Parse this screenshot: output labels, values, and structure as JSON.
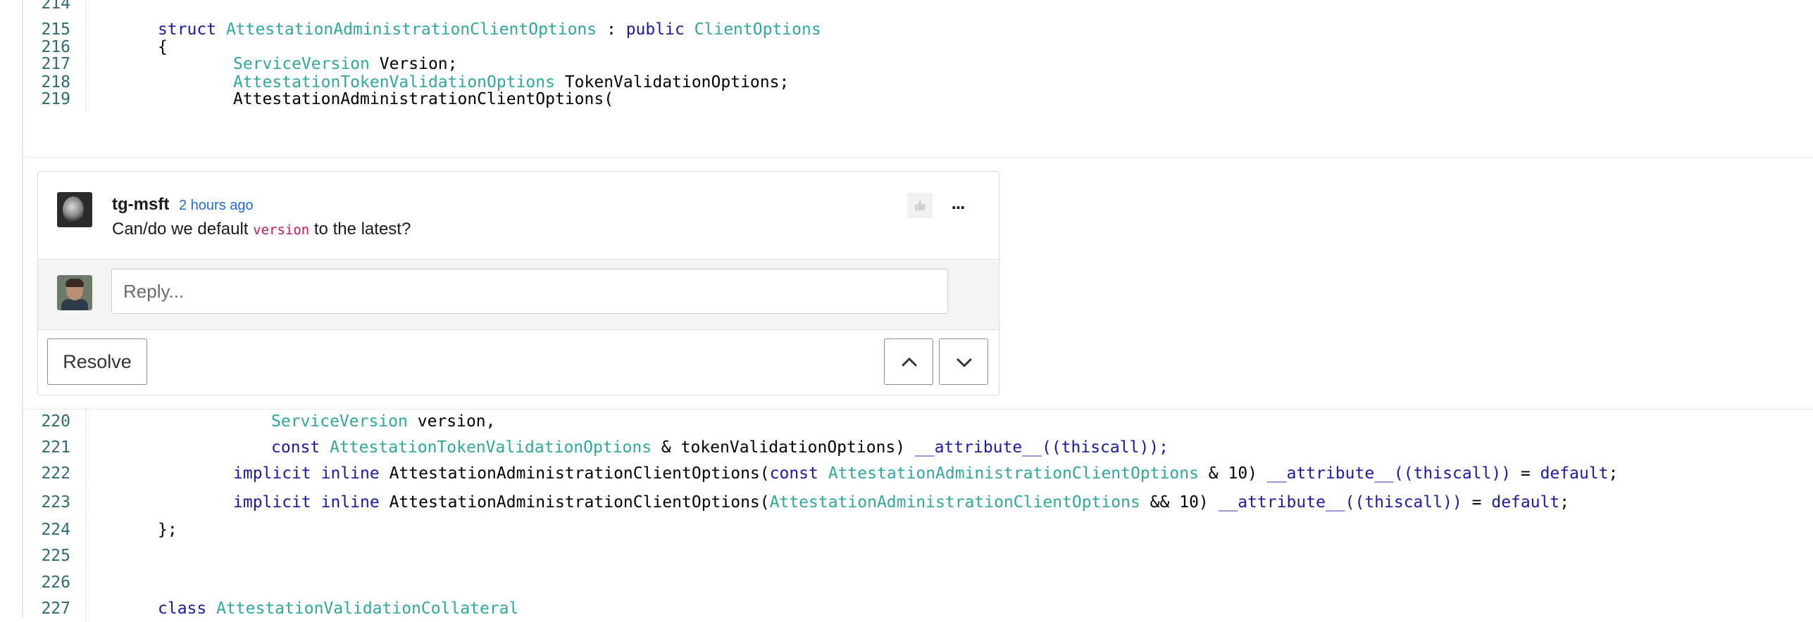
{
  "code_top": [
    {
      "ln": "214",
      "indent": 0,
      "tokens": []
    },
    {
      "ln": "215",
      "indent": 1,
      "tokens": [
        {
          "t": "struct",
          "c": "kw"
        },
        {
          "t": " ",
          "c": "pl"
        },
        {
          "t": "AttestationAdministrationClientOptions",
          "c": "ty"
        },
        {
          "t": " : ",
          "c": "pl"
        },
        {
          "t": "public",
          "c": "kw"
        },
        {
          "t": " ",
          "c": "pl"
        },
        {
          "t": "ClientOptions",
          "c": "ty"
        }
      ]
    },
    {
      "ln": "216",
      "indent": 1,
      "tokens": [
        {
          "t": "{",
          "c": "pl"
        }
      ]
    },
    {
      "ln": "217",
      "indent": 2,
      "tokens": [
        {
          "t": "ServiceVersion",
          "c": "ty"
        },
        {
          "t": " Version;",
          "c": "pl"
        }
      ]
    },
    {
      "ln": "218",
      "indent": 2,
      "tokens": [
        {
          "t": "AttestationTokenValidationOptions",
          "c": "ty"
        },
        {
          "t": " TokenValidationOptions;",
          "c": "pl"
        }
      ]
    },
    {
      "ln": "219",
      "indent": 2,
      "tokens": [
        {
          "t": "AttestationAdministrationClientOptions(",
          "c": "pl"
        }
      ]
    }
  ],
  "code_bottom": [
    {
      "ln": "220",
      "indent": 3,
      "tokens": [
        {
          "t": "ServiceVersion",
          "c": "ty"
        },
        {
          "t": " version,",
          "c": "pl"
        }
      ]
    },
    {
      "ln": "221",
      "indent": 3,
      "tokens": [
        {
          "t": "const",
          "c": "kw"
        },
        {
          "t": " ",
          "c": "pl"
        },
        {
          "t": "AttestationTokenValidationOptions",
          "c": "ty"
        },
        {
          "t": " & tokenValidationOptions) ",
          "c": "pl"
        },
        {
          "t": "__attribute__((thiscall));",
          "c": "kw"
        }
      ]
    },
    {
      "ln": "222",
      "indent": 2,
      "tokens": [
        {
          "t": "implicit",
          "c": "kw"
        },
        {
          "t": " ",
          "c": "pl"
        },
        {
          "t": "inline",
          "c": "kw"
        },
        {
          "t": " AttestationAdministrationClientOptions(",
          "c": "pl"
        },
        {
          "t": "const",
          "c": "kw"
        },
        {
          "t": " ",
          "c": "pl"
        },
        {
          "t": "AttestationAdministrationClientOptions",
          "c": "ty"
        },
        {
          "t": " & 10) ",
          "c": "pl"
        },
        {
          "t": "__attribute__((thiscall))",
          "c": "kw"
        },
        {
          "t": " = ",
          "c": "pl"
        },
        {
          "t": "default",
          "c": "kw"
        },
        {
          "t": ";",
          "c": "pl"
        }
      ]
    },
    {
      "ln": "223",
      "indent": 2,
      "tokens": [
        {
          "t": "implicit",
          "c": "kw"
        },
        {
          "t": " ",
          "c": "pl"
        },
        {
          "t": "inline",
          "c": "kw"
        },
        {
          "t": " AttestationAdministrationClientOptions(",
          "c": "pl"
        },
        {
          "t": "AttestationAdministrationClientOptions",
          "c": "ty"
        },
        {
          "t": " && 10) ",
          "c": "pl"
        },
        {
          "t": "__attribute__((thiscall))",
          "c": "kw"
        },
        {
          "t": " = ",
          "c": "pl"
        },
        {
          "t": "default",
          "c": "kw"
        },
        {
          "t": ";",
          "c": "pl"
        }
      ]
    },
    {
      "ln": "224",
      "indent": 1,
      "tokens": [
        {
          "t": "};",
          "c": "pl"
        }
      ]
    },
    {
      "ln": "225",
      "indent": 0,
      "tokens": []
    },
    {
      "ln": "226",
      "indent": 0,
      "tokens": []
    },
    {
      "ln": "227",
      "indent": 1,
      "tokens": [
        {
          "t": "class",
          "c": "kw"
        },
        {
          "t": " ",
          "c": "pl"
        },
        {
          "t": "AttestationValidationCollateral",
          "c": "ty"
        }
      ]
    }
  ],
  "thread": {
    "author": "tg-msft",
    "time": "2 hours ago",
    "comment_before": "Can/do we default ",
    "comment_code": "version",
    "comment_after": " to the latest?",
    "more_label": "...",
    "reply_placeholder": "Reply...",
    "resolve_label": "Resolve",
    "icons": {
      "like": "thumbs-up-icon",
      "up": "chevron-up-icon",
      "down": "chevron-down-icon"
    }
  }
}
